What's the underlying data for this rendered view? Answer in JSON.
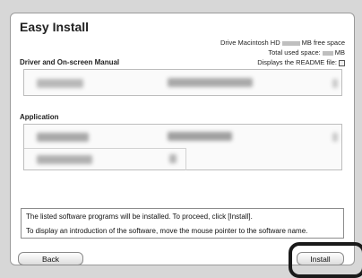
{
  "window": {
    "title": "Easy Install"
  },
  "disk_info": {
    "drive_prefix": "Drive Macintosh HD",
    "free_suffix": "MB free space",
    "used_prefix": "Total used space:",
    "used_suffix": "MB",
    "readme_label": "Displays the README file:"
  },
  "sections": {
    "driver": {
      "label": "Driver and On-screen Manual"
    },
    "application": {
      "label": "Application"
    }
  },
  "message": {
    "line1": "The listed software programs will be installed. To proceed, click [Install].",
    "line2": "To display an introduction of the software, move the mouse pointer to the software name."
  },
  "buttons": {
    "back": "Back",
    "install": "Install"
  }
}
